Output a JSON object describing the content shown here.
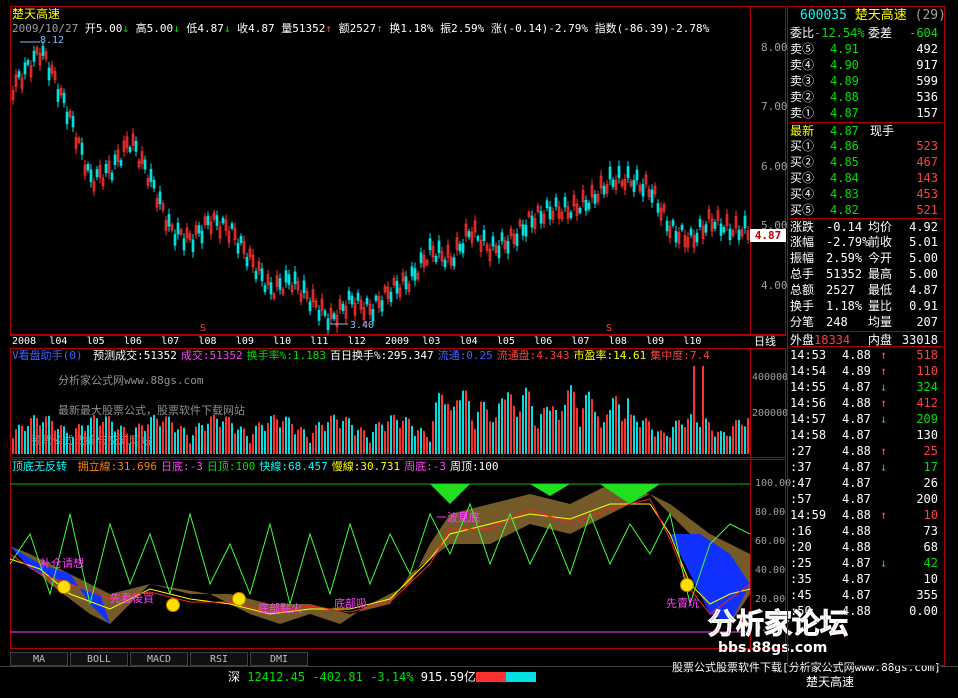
{
  "window": {
    "stock_title": "楚天高速"
  },
  "info_bar": {
    "date": "2009/10/27",
    "open": "开5.00",
    "high": "高5.00",
    "low": "低4.87",
    "close": "收4.87",
    "volume": "量51352",
    "amount": "额2527",
    "turnover": "换1.18%",
    "amplitude": "振2.59%",
    "change": "涨(-0.14)-2.79%",
    "index": "指数(-86.39)-2.78%",
    "max_label": "8.12",
    "min_label": "3.40",
    "cur_price_tag": "4.87"
  },
  "price_axis": [
    "8.00",
    "7.00",
    "6.00",
    "5.00",
    "4.00"
  ],
  "date_axis": [
    "2008",
    "l04",
    "l05",
    "l06",
    "l07",
    "l08",
    "l09",
    "l10",
    "l11",
    "l12",
    "2009",
    "l03",
    "l04",
    "l05",
    "l06",
    "l07",
    "l08",
    "l09",
    "l10"
  ],
  "period_button": "日线",
  "indicator1": {
    "title": "V看盘助手(0)",
    "items": [
      {
        "label": "预测成交:51352",
        "color": "#ffffff"
      },
      {
        "label": "成交:51352",
        "color": "#ff40ff"
      },
      {
        "label": "换手率%:1.183",
        "color": "#00e000"
      },
      {
        "label": "百日换手%:295.347",
        "color": "#ffffff"
      },
      {
        "label": "流通:0.25",
        "color": "#4060ff"
      },
      {
        "label": "流通盘:4.343",
        "color": "#ff4040"
      },
      {
        "label": "市盈率:14.61",
        "color": "#ffff00"
      },
      {
        "label": "集中度:7.4",
        "color": "#ff4040"
      }
    ],
    "axis": [
      "400000",
      "200000"
    ],
    "watermarks": [
      "分析家公式网www.88gs.com",
      "最新最大股票公式，股票软件下载网站",
      "股票公式改编与交流网站"
    ]
  },
  "indicator2": {
    "title": "顶底无反转",
    "items": [
      {
        "label": "拥立線:31.696",
        "color": "#ff8000"
      },
      {
        "label": "日底:-3",
        "color": "#ff40ff"
      },
      {
        "label": "日顶:100",
        "color": "#00e000"
      },
      {
        "label": "快線:68.457",
        "color": "#00ffff"
      },
      {
        "label": "慢線:30.731",
        "color": "#ffff00"
      },
      {
        "label": "周底:-3",
        "color": "#ff40ff"
      },
      {
        "label": "周顶:100",
        "color": "#ffffff"
      }
    ],
    "axis": [
      "100.00",
      "80.00",
      "60.00",
      "40.00",
      "20.00",
      "0.00"
    ],
    "annotations": [
      "补仓请想",
      "先看後買",
      "底部點火",
      "底部吸",
      "一波見底",
      "先賣坑"
    ]
  },
  "bottom_tabs": [
    "MA",
    "BOLL",
    "MACD",
    "RSI",
    "DMI"
  ],
  "status_bar": {
    "market": "深",
    "index": "12412.45",
    "change": "-402.81",
    "pct": "-3.14%",
    "amount": "915.59亿",
    "ticker": "股票公式股票软件下载[分析家公式网www.88gs.com]"
  },
  "watermark_brand": {
    "title": "分析家论坛",
    "url": "bbs.88gs.com"
  },
  "quote_panel": {
    "code": "600035",
    "name": "楚天高速",
    "rank": "(29)",
    "weibi": {
      "label": "委比",
      "value": "-12.54%",
      "diff_label": "委差",
      "diff": "-604"
    },
    "asks": [
      {
        "label": "卖⑤",
        "price": "4.91",
        "vol": "492"
      },
      {
        "label": "卖④",
        "price": "4.90",
        "vol": "917"
      },
      {
        "label": "卖③",
        "price": "4.89",
        "vol": "599"
      },
      {
        "label": "卖②",
        "price": "4.88",
        "vol": "536"
      },
      {
        "label": "卖①",
        "price": "4.87",
        "vol": "157"
      }
    ],
    "last": {
      "label": "最新",
      "price": "4.87",
      "vol_label": "现手"
    },
    "bids": [
      {
        "label": "买①",
        "price": "4.86",
        "vol": "523"
      },
      {
        "label": "买②",
        "price": "4.85",
        "vol": "467"
      },
      {
        "label": "买③",
        "price": "4.84",
        "vol": "143"
      },
      {
        "label": "买④",
        "price": "4.83",
        "vol": "453"
      },
      {
        "label": "买⑤",
        "price": "4.82",
        "vol": "521"
      }
    ],
    "stats": [
      {
        "l1": "涨跌",
        "v1": "-0.14",
        "l2": "均价",
        "v2": "4.92"
      },
      {
        "l1": "涨幅",
        "v1": "-2.79%",
        "l2": "前收",
        "v2": "5.01"
      },
      {
        "l1": "振幅",
        "v1": "2.59%",
        "l2": "今开",
        "v2": "5.00"
      },
      {
        "l1": "总手",
        "v1": "51352",
        "l2": "最高",
        "v2": "5.00"
      },
      {
        "l1": "总额",
        "v1": "2527",
        "l2": "最低",
        "v2": "4.87"
      },
      {
        "l1": "换手",
        "v1": "1.18%",
        "l2": "量比",
        "v2": "0.91"
      },
      {
        "l1": "分笔",
        "v1": "248",
        "l2": "均量",
        "v2": "207"
      }
    ],
    "outer": {
      "label": "外盘",
      "value": "18334",
      "inner_label": "内盘",
      "inner": "33018"
    },
    "ticks": [
      {
        "t": "14:53",
        "p": "4.88",
        "d": "up",
        "v": "518"
      },
      {
        "t": "14:54",
        "p": "4.89",
        "d": "up",
        "v": "110"
      },
      {
        "t": "14:55",
        "p": "4.87",
        "d": "down",
        "v": "324"
      },
      {
        "t": "14:56",
        "p": "4.88",
        "d": "up",
        "v": "412"
      },
      {
        "t": "14:57",
        "p": "4.87",
        "d": "down",
        "v": "209"
      },
      {
        "t": "14:58",
        "p": "4.87",
        "d": "",
        "v": "130"
      },
      {
        "t": ":27",
        "p": "4.88",
        "d": "up",
        "v": "25"
      },
      {
        "t": ":37",
        "p": "4.87",
        "d": "down",
        "v": "17"
      },
      {
        "t": ":47",
        "p": "4.87",
        "d": "",
        "v": "26"
      },
      {
        "t": ":57",
        "p": "4.87",
        "d": "",
        "v": "200"
      },
      {
        "t": "14:59",
        "p": "4.88",
        "d": "up",
        "v": "10"
      },
      {
        "t": ":16",
        "p": "4.88",
        "d": "",
        "v": "73"
      },
      {
        "t": ":20",
        "p": "4.88",
        "d": "",
        "v": "68"
      },
      {
        "t": ":25",
        "p": "4.87",
        "d": "down",
        "v": "42"
      },
      {
        "t": ":35",
        "p": "4.87",
        "d": "",
        "v": "10"
      },
      {
        "t": ":45",
        "p": "4.87",
        "d": "",
        "v": "355"
      },
      {
        "t": ":50",
        "p": "4.88",
        "d": "",
        "v": "0.00"
      }
    ],
    "footer": "楚天高速"
  }
}
